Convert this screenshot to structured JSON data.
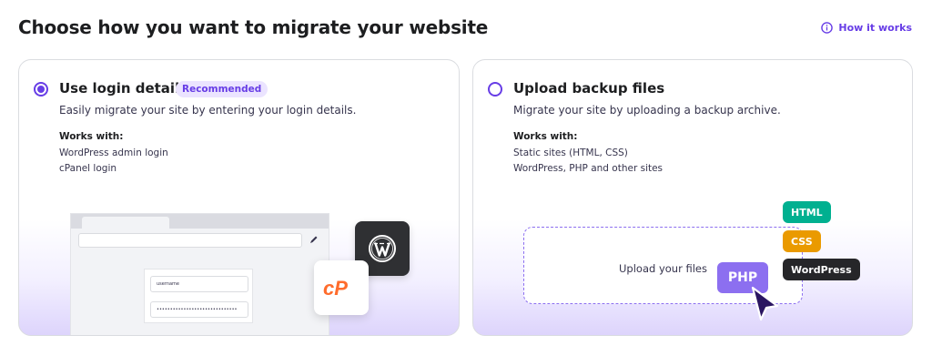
{
  "header": {
    "title": "Choose how you want to migrate your website",
    "how_it_works": "How it works"
  },
  "options": [
    {
      "title": "Use login details",
      "badge": "Recommended",
      "description": "Easily migrate your site by entering your login details.",
      "works_with_label": "Works with:",
      "works_with": [
        "WordPress admin login",
        "cPanel login"
      ],
      "selected": true,
      "illustration": {
        "username_placeholder": "username",
        "password_mask": "••••••••••••••••••••••••••••••",
        "cpanel_logo_text": "cP"
      }
    },
    {
      "title": "Upload backup files",
      "description": "Migrate your site by uploading a backup archive.",
      "works_with_label": "Works with:",
      "works_with": [
        "Static sites (HTML, CSS)",
        "WordPress, PHP and other sites"
      ],
      "selected": false,
      "illustration": {
        "upload_text": "Upload your files",
        "php_chip": "PHP",
        "chips": [
          "HTML",
          "CSS",
          "WordPress"
        ]
      }
    }
  ],
  "colors": {
    "accent": "#673de6",
    "html_chip": "#00b090",
    "css_chip": "#ea9a00",
    "wordpress_chip": "#262629",
    "cpanel_orange": "#ff6c2c"
  }
}
